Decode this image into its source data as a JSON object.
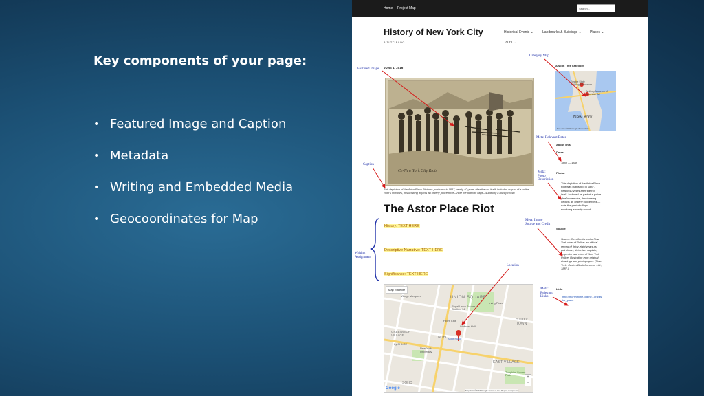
{
  "slide": {
    "title": "Key components of your page:",
    "bullets": [
      "Featured Image and Caption",
      "Metadata",
      "Writing and Embedded Media",
      "Geocoordinates for Map"
    ]
  },
  "site": {
    "nav": [
      "Home",
      "Project Map"
    ],
    "search_placeholder": "Search...",
    "title": "History of New York City",
    "subtitle": "A TLTC BLOG",
    "menu": [
      "Historical Events ⌄",
      "Landmarks & Buildings ⌄",
      "Places ⌄",
      "Tours ⌄"
    ]
  },
  "post": {
    "date": "JUNE 1, 2016",
    "image_inscription": "Ce-New York City Riots",
    "caption": "This depiction of the Astor Place Riot was published in 1887, nearly 40 years after the riot itself. Included as part of a police chief's memoirs, this drawing depicts an orderly police force—note the patriotic flags—subduing a rowdy crowd.",
    "title": "The Astor Place Riot",
    "sections": [
      "History: TEXT HERE",
      "Descriptive Narrative: TEXT HERE",
      "Significance: TEXT HERE"
    ]
  },
  "map": {
    "tabs": [
      "Map",
      "Satellite"
    ],
    "labels": [
      "Village Vanguard",
      "UNION SQUARE",
      "Regal Union Square Stadium 14",
      "Irving Plaza",
      "Flight Club",
      "Webster Hall",
      "NOHO",
      "Astor Place",
      "New York University",
      "GREENWICH VILLAGE",
      "by CHLOE",
      "STUYV TOWN",
      "EAST VILLAGE",
      "Tompkins Square Park",
      "SOHO"
    ],
    "footer": "Map data ©2016 Google   Terms of Use   Report a map error",
    "logo": "Google"
  },
  "sidebar": {
    "category_heading": "Also In This Category",
    "map_labels": [
      "Empire State Building & Museum",
      "Whitney Museum of American Art",
      "New York"
    ],
    "map_footer": "Map data ©2016 Google   Terms of Use",
    "about_heading": "About This",
    "dates_label": "Dates:",
    "dates_value": "1849 — 1849",
    "photo_label": "Photo:",
    "photo_text": [
      "This depiction of the Astor Place",
      "Riot was published in 1887,",
      "nearly 40 years after the riot",
      "itself. Included as part of a police",
      "chief's memoirs, this drawing",
      "depicts an orderly police force—",
      "note the patriotic flags—",
      "subduing a rowdy crowd."
    ],
    "source_label": "Source:",
    "source_text": [
      "Source: Recollections of a New",
      "York chief of Police: an official",
      "record of thirty-eight years as",
      "patrolman, detective, captain,",
      "inspector and chief of New York",
      "Police. Illustration from original",
      "drawings and photographs. (New",
      "York: Caxton Book Concern, Ltd.,",
      "1887.)"
    ],
    "link_label": "Link:",
    "link_text": [
      "http://mcnyonline.org/ne...org/as",
      "tor_place"
    ]
  },
  "annotations": {
    "category_map": "Category Map",
    "featured_image": "Featured Image",
    "relevant_dates": "Meta: Relevant Dates",
    "caption": "Caption",
    "photo_description": [
      "Meta:",
      "Photo",
      "Description"
    ],
    "image_source": [
      "Meta: Image",
      "Source and Credit"
    ],
    "writing_assignment": [
      "Writing",
      "Assignment"
    ],
    "location": "Location",
    "relevant_links": [
      "Meta:",
      "Relevant",
      "Links"
    ]
  },
  "colors": {
    "annotation_arrow": "#d61a1a",
    "annotation_text": "#2233aa",
    "highlight": "#fff59a"
  }
}
